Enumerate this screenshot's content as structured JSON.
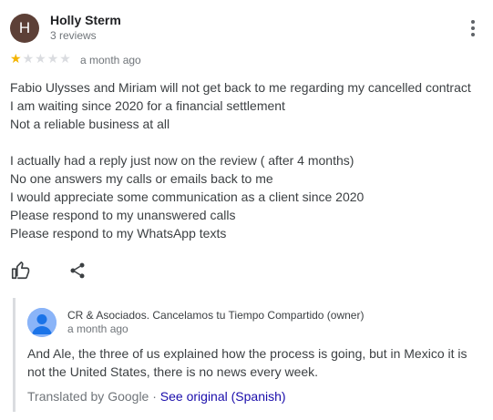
{
  "review": {
    "author": {
      "initial": "H",
      "name": "Holly Sterm",
      "meta": "3 reviews",
      "avatar_color": "#5d4037"
    },
    "rating": {
      "value": 1,
      "max": 5,
      "filled_color": "#f4b400",
      "empty_color": "#dadce0"
    },
    "time": "a month ago",
    "lines": [
      "Fabio Ulysses and Miriam will not get back to me regarding my cancelled contract",
      "I am waiting since 2020 for a financial settlement",
      "Not a reliable business at all",
      "",
      "I actually had a reply just now on the review ( after 4 months)",
      "No one answers my calls or emails back to me",
      "I would appreciate some communication as a client since 2020",
      "Please respond to my unanswered calls",
      "Please respond to my WhatsApp texts"
    ],
    "actions": {
      "like_icon": "thumbs-up-icon",
      "share_icon": "share-icon",
      "menu_icon": "more-vert-icon"
    }
  },
  "owner_reply": {
    "name": "CR & Asociados. Cancelamos tu Tiempo Compartido (owner)",
    "time": "a month ago",
    "avatar_icon": "person-icon",
    "avatar_color": "#8ab4f8",
    "text": "And Ale, the three of us explained how the process is going, but in Mexico it is not the United States, there is no news every week.",
    "translated_label": "Translated by Google",
    "separator": "·",
    "see_original": "See original (Spanish)"
  }
}
